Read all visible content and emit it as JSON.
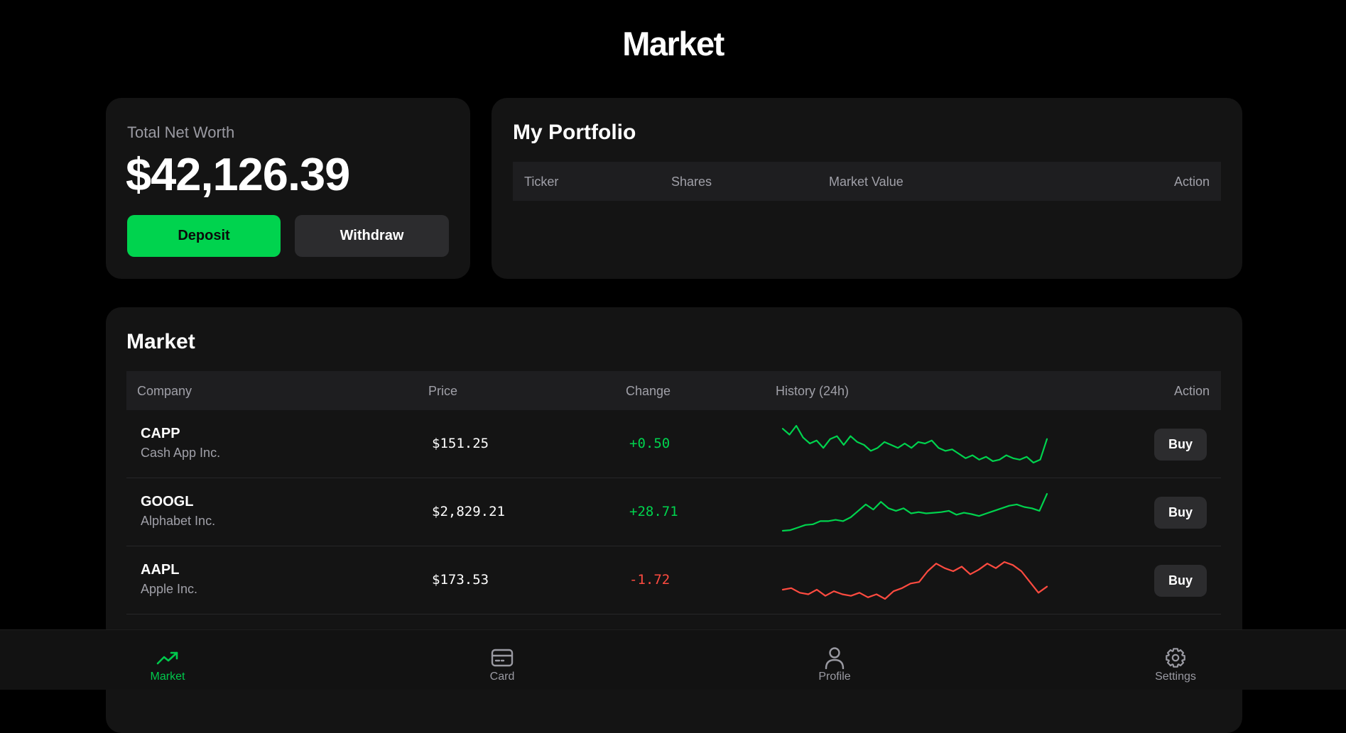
{
  "page_title": "Market",
  "networth": {
    "label": "Total Net Worth",
    "amount": "$42,126.39",
    "deposit_label": "Deposit",
    "withdraw_label": "Withdraw"
  },
  "portfolio": {
    "title": "My Portfolio",
    "columns": [
      "Ticker",
      "Shares",
      "Market Value",
      "Action"
    ],
    "rows": []
  },
  "market": {
    "title": "Market",
    "columns": [
      "Company",
      "Price",
      "Change",
      "History (24h)",
      "Action"
    ],
    "rows": [
      {
        "ticker": "CAPP",
        "company": "Cash App Inc.",
        "price": "$151.25",
        "change": "+0.50",
        "trend": "up",
        "buy_label": "Buy",
        "history": [
          151.6,
          151.4,
          151.7,
          151.3,
          151.1,
          151.2,
          150.95,
          151.25,
          151.35,
          151.05,
          151.35,
          151.15,
          151.05,
          150.85,
          150.95,
          151.15,
          151.05,
          150.95,
          151.1,
          150.95,
          151.15,
          151.1,
          151.2,
          150.95,
          150.85,
          150.9,
          150.75,
          150.6,
          150.7,
          150.55,
          150.65,
          150.5,
          150.55,
          150.7,
          150.6,
          150.55,
          150.65,
          150.45,
          150.55,
          151.25
        ]
      },
      {
        "ticker": "GOOGL",
        "company": "Alphabet Inc.",
        "price": "$2,829.21",
        "change": "+28.71",
        "trend": "up",
        "buy_label": "Buy",
        "history": [
          2800.5,
          2801,
          2803,
          2805,
          2805.5,
          2808,
          2808,
          2809,
          2808,
          2811,
          2816,
          2821,
          2817,
          2823,
          2818,
          2816,
          2818,
          2814,
          2815,
          2814,
          2814.5,
          2815,
          2816,
          2813,
          2814.5,
          2813.5,
          2812,
          2814,
          2816,
          2818,
          2820,
          2821,
          2819,
          2818,
          2816,
          2829.21
        ]
      },
      {
        "ticker": "AAPL",
        "company": "Apple Inc.",
        "price": "$173.53",
        "change": "-1.72",
        "trend": "down",
        "buy_label": "Buy",
        "history": [
          175.0,
          175.1,
          174.8,
          174.7,
          175.0,
          174.6,
          174.9,
          174.7,
          174.6,
          174.8,
          174.5,
          174.7,
          174.4,
          174.9,
          175.1,
          175.4,
          175.5,
          176.2,
          176.7,
          176.4,
          176.2,
          176.5,
          176.0,
          176.3,
          176.7,
          176.4,
          176.8,
          176.6,
          176.2,
          175.5,
          174.8,
          175.2
        ]
      }
    ]
  },
  "nav": [
    {
      "label": "Market",
      "icon": "trending-up-icon",
      "active": true
    },
    {
      "label": "Card",
      "icon": "card-icon",
      "active": false
    },
    {
      "label": "Profile",
      "icon": "person-icon",
      "active": false
    },
    {
      "label": "Settings",
      "icon": "gear-icon",
      "active": false
    }
  ],
  "colors": {
    "accent": "#00d34e",
    "positive": "#00d34e",
    "negative": "#ff4b40",
    "surface": "#141414",
    "background": "#000000"
  }
}
